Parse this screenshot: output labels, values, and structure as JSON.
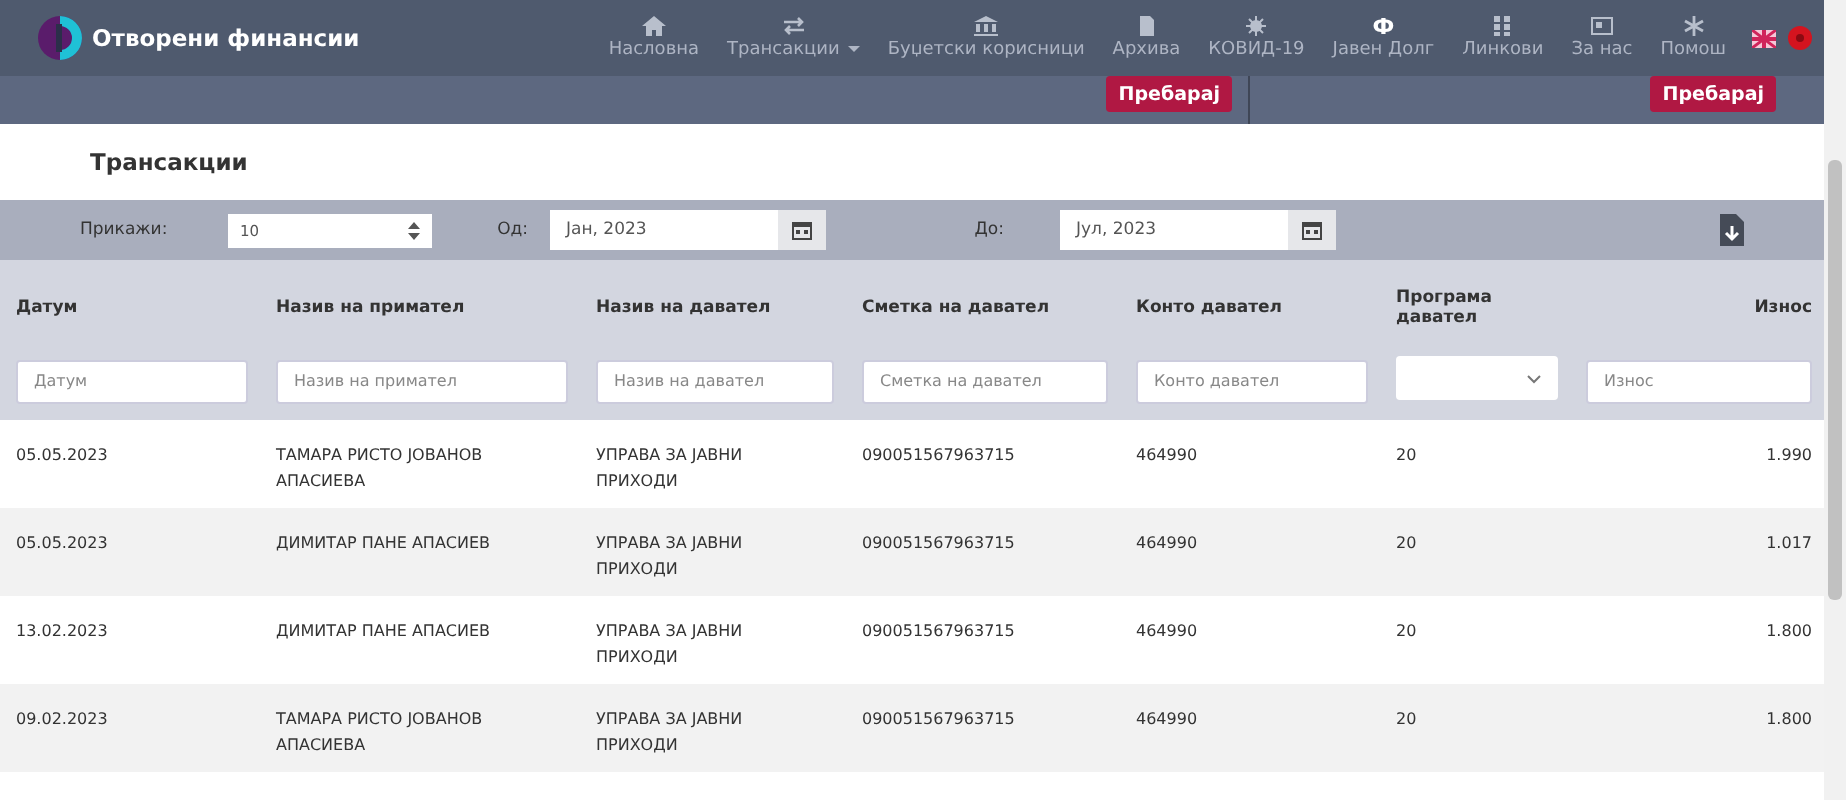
{
  "brand": {
    "name": "Отворени финансии"
  },
  "nav": [
    {
      "label": "Насловна",
      "dropdown": false
    },
    {
      "label": "Трансакции",
      "dropdown": true
    },
    {
      "label": "Буџетски корисници",
      "dropdown": false
    },
    {
      "label": "Архива",
      "dropdown": false
    },
    {
      "label": "КОВИД-19",
      "dropdown": false
    },
    {
      "glyph": "Ф",
      "label": "Јавен Долг",
      "dropdown": false
    },
    {
      "label": "Линкови",
      "dropdown": false
    },
    {
      "label": "За нас",
      "dropdown": false
    },
    {
      "label": "Помош",
      "dropdown": false
    }
  ],
  "search_buttons": [
    "Пребарај",
    "Пребарај"
  ],
  "section_title": "Трансакции",
  "filters": {
    "show_label": "Прикажи:",
    "show_value": "10",
    "from_label": "Од:",
    "from_value": "Јан, 2023",
    "to_label": "До:",
    "to_value": "Јул, 2023"
  },
  "table": {
    "columns": [
      {
        "label": "Датум",
        "filter": {
          "kind": "input",
          "placeholder": "Датум"
        }
      },
      {
        "label": "Назив на примател",
        "filter": {
          "kind": "input",
          "placeholder": "Назив на примател"
        }
      },
      {
        "label": "Назив на давател",
        "filter": {
          "kind": "input",
          "placeholder": "Назив на давател"
        }
      },
      {
        "label": "Сметка на давател",
        "filter": {
          "kind": "input",
          "placeholder": "Сметка на давател"
        }
      },
      {
        "label": "Конто давател",
        "filter": {
          "kind": "input",
          "placeholder": "Конто давател"
        }
      },
      {
        "label": "Програма давател",
        "filter": {
          "kind": "select"
        }
      },
      {
        "label": "Износ",
        "filter": {
          "kind": "input",
          "placeholder": "Износ"
        }
      }
    ],
    "rows": [
      [
        "05.05.2023",
        "ТАМАРА РИСТО ЈОВАНОВ АПАСИЕВА",
        "УПРАВА ЗА ЈАВНИ ПРИХОДИ",
        "090051567963715",
        "464990",
        "20",
        "1.990"
      ],
      [
        "05.05.2023",
        "ДИМИТАР ПАНЕ АПАСИЕВ",
        "УПРАВА ЗА ЈАВНИ ПРИХОДИ",
        "090051567963715",
        "464990",
        "20",
        "1.017"
      ],
      [
        "13.02.2023",
        "ДИМИТАР ПАНЕ АПАСИЕВ",
        "УПРАВА ЗА ЈАВНИ ПРИХОДИ",
        "090051567963715",
        "464990",
        "20",
        "1.800"
      ],
      [
        "09.02.2023",
        "ТАМАРА РИСТО ЈОВАНОВ АПАСИЕВА",
        "УПРАВА ЗА ЈАВНИ ПРИХОДИ",
        "090051567963715",
        "464990",
        "20",
        "1.800"
      ]
    ]
  }
}
